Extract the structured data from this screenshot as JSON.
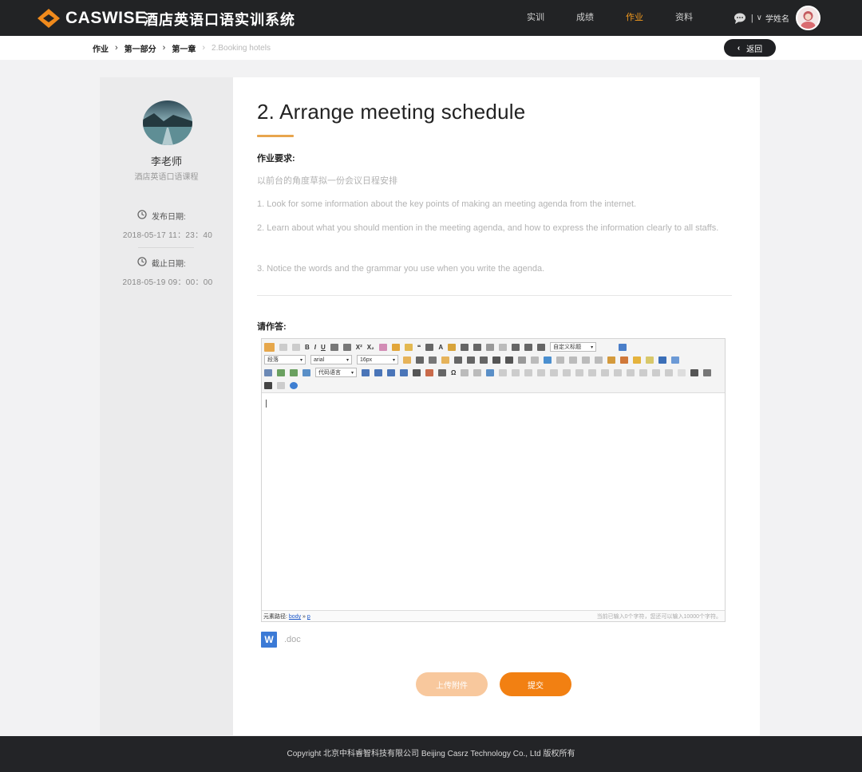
{
  "header": {
    "logo_text": "CASWISE",
    "system_title": "酒店英语口语实训系统",
    "nav": [
      {
        "label": "实训",
        "active": false
      },
      {
        "label": "成绩",
        "active": false
      },
      {
        "label": "作业",
        "active": true
      },
      {
        "label": "资料",
        "active": false
      }
    ],
    "separator": "|",
    "user_name": "学姓名",
    "accent_color": "#f39a1e"
  },
  "breadcrumb": {
    "items": [
      "作业",
      "第一部分",
      "第一章",
      "2.Booking hotels"
    ],
    "back_label": "返回"
  },
  "sidebar": {
    "teacher_name": "李老师",
    "course": "酒店英语口语课程",
    "publish_label": "发布日期:",
    "publish_date": "2018-05-17 11：23：40",
    "deadline_label": "截止日期:",
    "deadline_date": "2018-05-19 09：00：00"
  },
  "assignment": {
    "title": "2. Arrange meeting schedule",
    "requirements_label": "作业要求:",
    "requirements": [
      "以前台的角度草拟一份会议日程安排",
      "1. Look for some information about the key points of making an meeting agenda from the internet.",
      "2. Learn about what you should mention in the meeting agenda, and how to express the information clearly to all staffs.",
      "3. Notice the words and the grammar you use when you write the agenda."
    ],
    "answer_label": "请作答:"
  },
  "editor": {
    "select_paragraph": "段落",
    "select_font": "arial",
    "select_size": "16px",
    "select_title": "自定义标题",
    "select_code": "代码语言",
    "status_path_label": "元素路径:",
    "status_path_body": "body",
    "status_path_sep": "»",
    "status_path_p": "p",
    "status_count": "当前已输入0个字符，您还可以输入10000个字符。"
  },
  "attachment": {
    "icon_letter": "W",
    "label": ".doc"
  },
  "actions": {
    "upload_label": "上传附件",
    "submit_label": "提交"
  },
  "footer": {
    "copyright": "Copyright 北京中科睿智科技有限公司 Beijing Casrz Technology Co., Ltd 版权所有"
  }
}
